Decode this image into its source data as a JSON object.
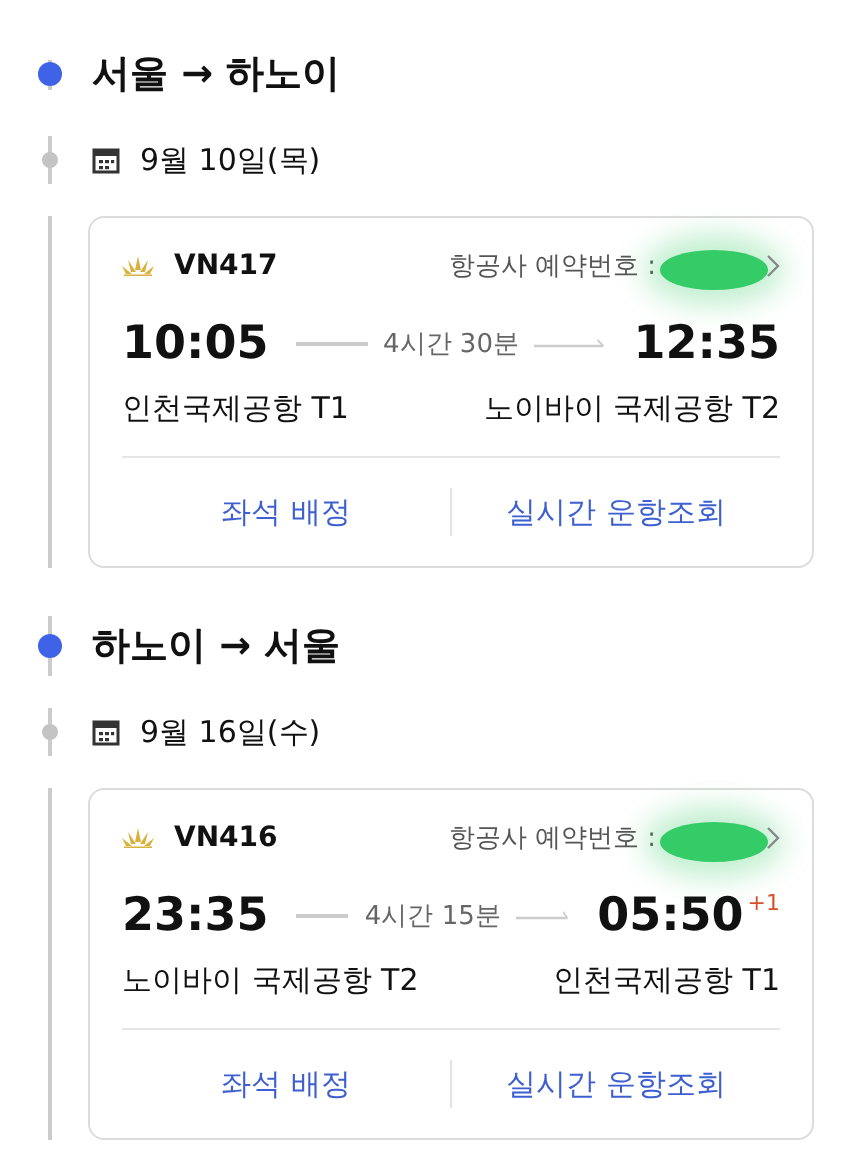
{
  "trips": [
    {
      "route": "서울 → 하노이",
      "date": "9월 10일(목)",
      "flight": {
        "number": "VN417",
        "booking_label": "항공사 예약번호 :",
        "booking_redacted": true,
        "departure_time": "10:05",
        "duration": "4시간 30분",
        "arrival_time": "12:35",
        "departure_airport": "인천국제공항 T1",
        "arrival_airport": "노이바이 국제공항 T2",
        "actions": [
          "좌석 배정",
          "실시간 운항조회"
        ]
      }
    },
    {
      "route": "하노이 → 서울",
      "date": "9월 16일(수)",
      "flight": {
        "number": "VN416",
        "booking_label": "항공사 예약번호 :",
        "booking_redacted": true,
        "departure_time": "23:35",
        "duration": "4시간 15분",
        "arrival_time": "05:50",
        "day_offset": "+1",
        "departure_airport": "노이바이 국제공항 T2",
        "arrival_airport": "인천국제공항 T1",
        "actions": [
          "좌석 배정",
          "실시간 운항조회"
        ]
      }
    }
  ]
}
